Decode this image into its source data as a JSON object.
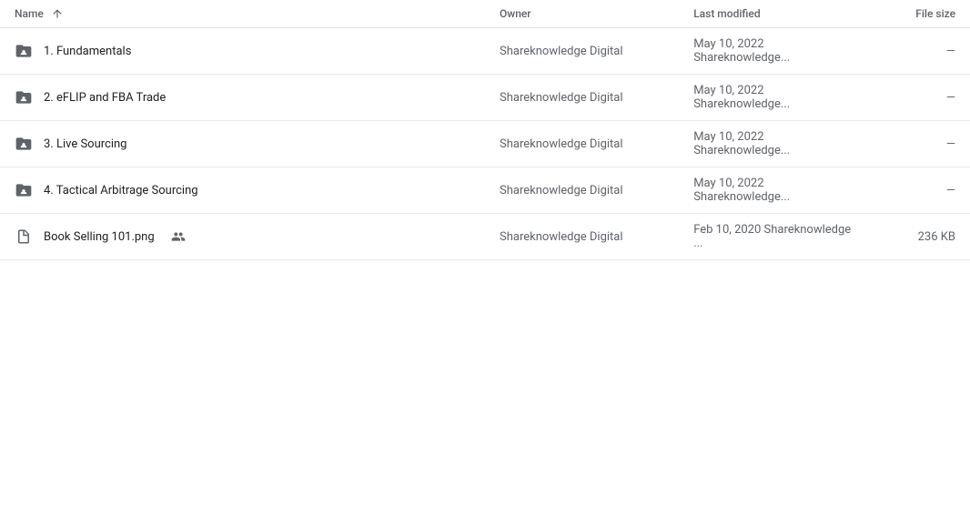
{
  "table": {
    "columns": {
      "name": "Name",
      "owner": "Owner",
      "last_modified": "Last modified",
      "file_size": "File size"
    },
    "rows": [
      {
        "id": 1,
        "type": "folder",
        "name": "1. Fundamentals",
        "owner": "Shareknowledge Digital",
        "modified_date": "May 10, 2022",
        "modified_by": "Shareknowledge...",
        "file_size": "—",
        "shared": false
      },
      {
        "id": 2,
        "type": "folder",
        "name": "2. eFLIP and FBA Trade",
        "owner": "Shareknowledge Digital",
        "modified_date": "May 10, 2022",
        "modified_by": "Shareknowledge...",
        "file_size": "—",
        "shared": false
      },
      {
        "id": 3,
        "type": "folder",
        "name": "3. Live Sourcing",
        "owner": "Shareknowledge Digital",
        "modified_date": "May 10, 2022",
        "modified_by": "Shareknowledge...",
        "file_size": "—",
        "shared": false
      },
      {
        "id": 4,
        "type": "folder",
        "name": "4. Tactical Arbitrage Sourcing",
        "owner": "Shareknowledge Digital",
        "modified_date": "May 10, 2022",
        "modified_by": "Shareknowledge...",
        "file_size": "—",
        "shared": false
      },
      {
        "id": 5,
        "type": "file",
        "name": "Book Selling 101.png",
        "owner": "Shareknowledge Digital",
        "modified_date": "Feb 10, 2020",
        "modified_by": "Shareknowledge ...",
        "file_size": "236 KB",
        "shared": true
      }
    ]
  }
}
